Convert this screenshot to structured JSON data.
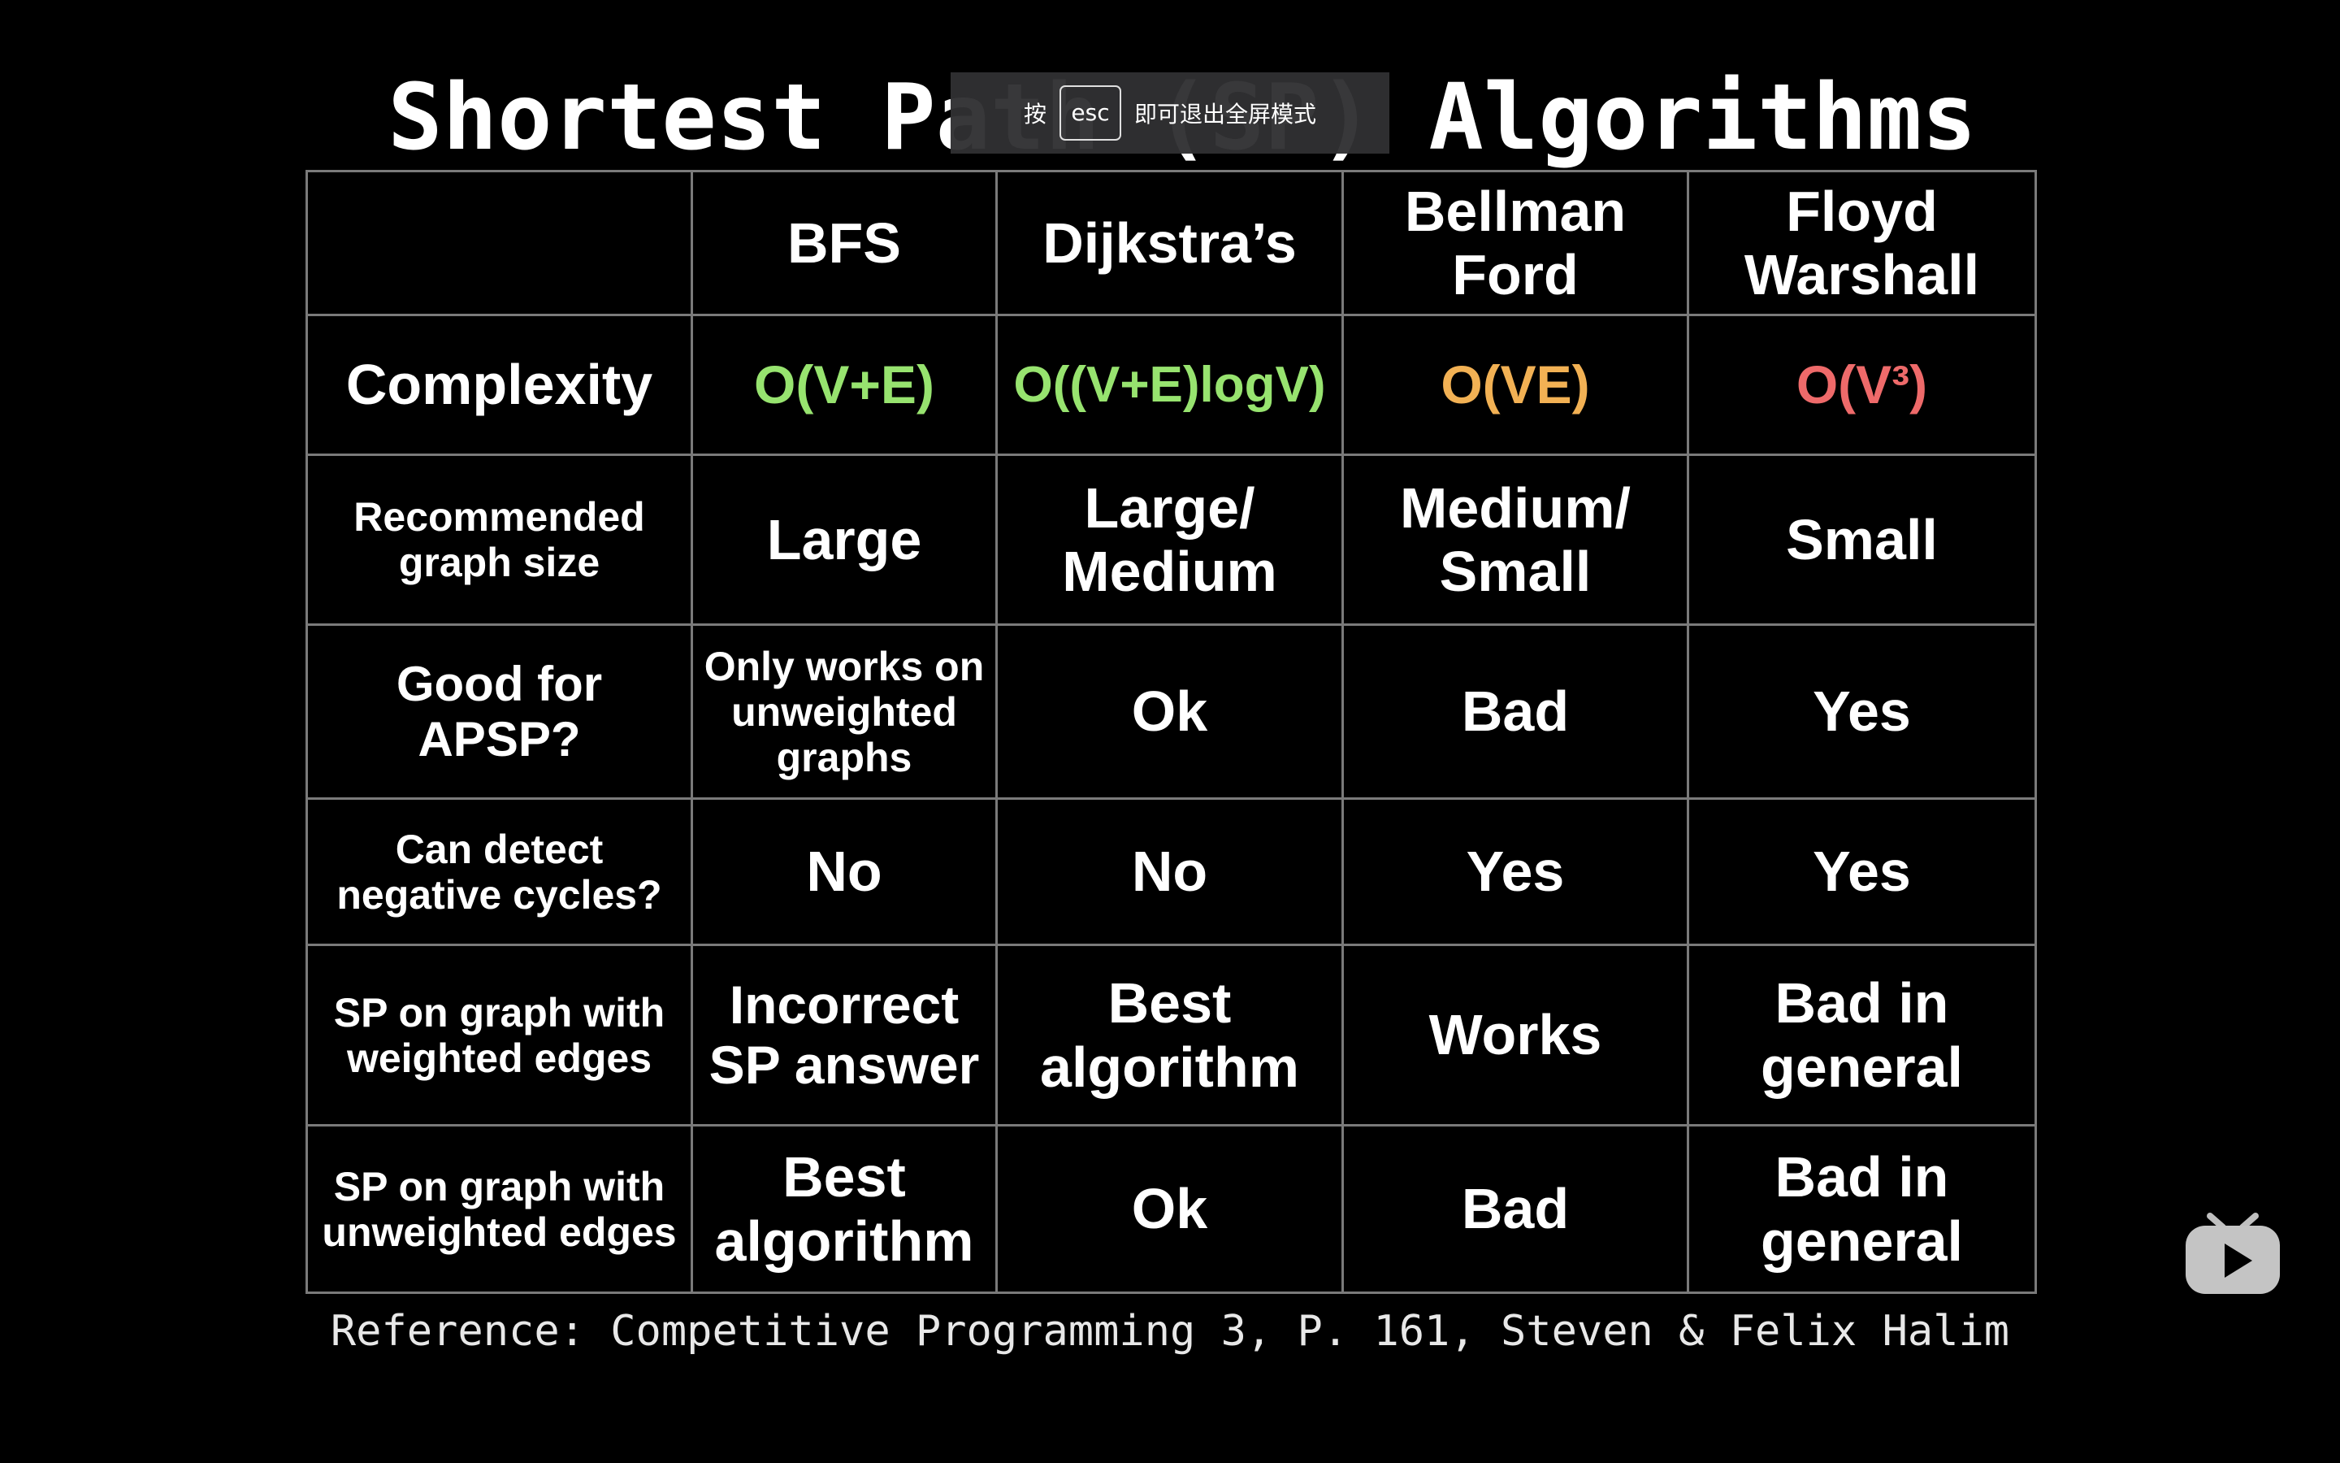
{
  "title": "Shortest Path (SP) Algorithms",
  "fullscreen_hint": {
    "prefix": "按",
    "key": "esc",
    "suffix": "即可退出全屏模式"
  },
  "table": {
    "columns": [
      "",
      "BFS",
      "Dijkstra’s",
      "Bellman Ford",
      "Floyd Warshall"
    ],
    "rows": [
      {
        "label": "Complexity",
        "cells": [
          {
            "text": "O(V+E)",
            "color": "#97e36f"
          },
          {
            "text": "O((V+E)logV)",
            "color": "#97e36f"
          },
          {
            "text": "O(VE)",
            "color": "#f2b154"
          },
          {
            "text": "O(V³)",
            "color": "#ee6a6a"
          }
        ]
      },
      {
        "label": "Recommended graph size",
        "cells": [
          {
            "text": "Large"
          },
          {
            "text": "Large/ Medium"
          },
          {
            "text": "Medium/ Small"
          },
          {
            "text": "Small"
          }
        ]
      },
      {
        "label": "Good for APSP?",
        "cells": [
          {
            "text": "Only works on unweighted graphs"
          },
          {
            "text": "Ok"
          },
          {
            "text": "Bad"
          },
          {
            "text": "Yes"
          }
        ]
      },
      {
        "label": "Can detect negative cycles?",
        "cells": [
          {
            "text": "No"
          },
          {
            "text": "No"
          },
          {
            "text": "Yes"
          },
          {
            "text": "Yes"
          }
        ]
      },
      {
        "label": "SP on graph with weighted edges",
        "cells": [
          {
            "text": "Incorrect SP answer"
          },
          {
            "text": "Best algorithm"
          },
          {
            "text": "Works"
          },
          {
            "text": "Bad in general"
          }
        ]
      },
      {
        "label": "SP on graph with unweighted edges",
        "cells": [
          {
            "text": "Best algorithm"
          },
          {
            "text": "Ok"
          },
          {
            "text": "Bad"
          },
          {
            "text": "Bad in general"
          }
        ]
      }
    ]
  },
  "reference": "Reference: Competitive Programming 3, P. 161, Steven & Felix Halim",
  "player_logo_icon": "tv-play-icon"
}
